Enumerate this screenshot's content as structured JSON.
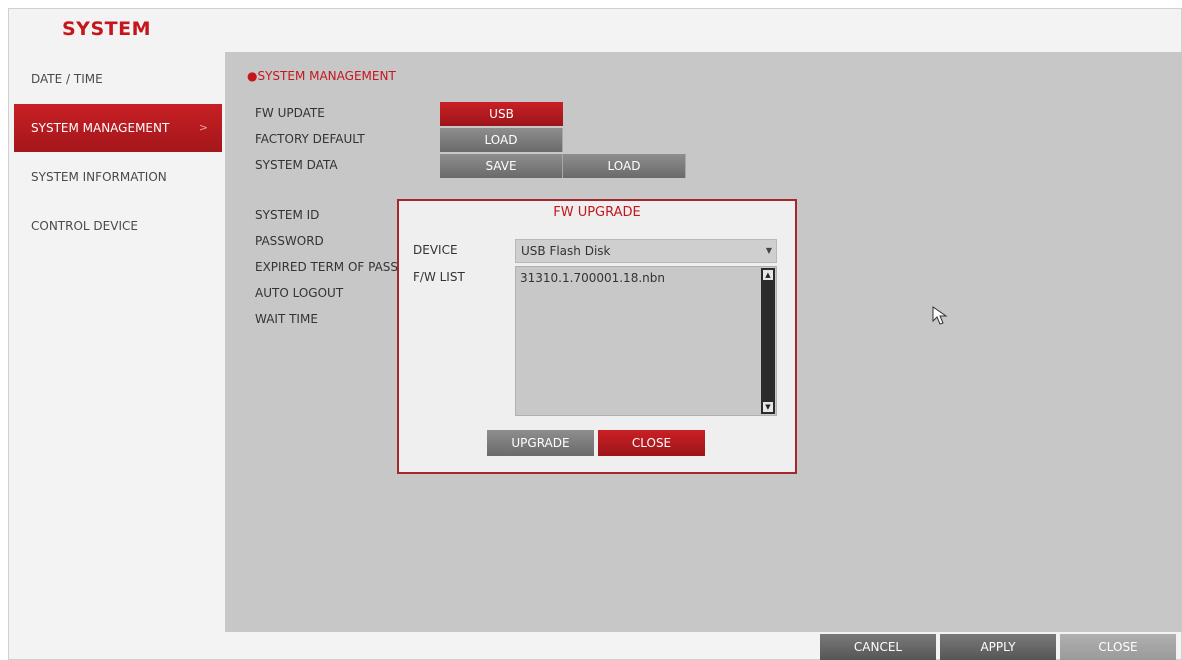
{
  "app": {
    "title": "SYSTEM"
  },
  "sidebar": {
    "items": [
      {
        "label": "DATE / TIME",
        "active": false
      },
      {
        "label": "SYSTEM MANAGEMENT",
        "active": true
      },
      {
        "label": "SYSTEM INFORMATION",
        "active": false
      },
      {
        "label": "CONTROL DEVICE",
        "active": false
      }
    ],
    "active_arrow": ">"
  },
  "main": {
    "section_title": "●SYSTEM MANAGEMENT",
    "rows": {
      "fw_update": {
        "label": "FW UPDATE",
        "button": "USB"
      },
      "factory_default": {
        "label": "FACTORY DEFAULT",
        "button": "LOAD"
      },
      "system_data": {
        "label": "SYSTEM DATA",
        "save_button": "SAVE",
        "load_button": "LOAD"
      }
    },
    "labels": {
      "system_id": "SYSTEM ID",
      "password": "PASSWORD",
      "expired_term": "EXPIRED TERM OF PASS",
      "auto_logout": "AUTO LOGOUT",
      "wait_time": "WAIT TIME"
    }
  },
  "dialog": {
    "title": "FW UPGRADE",
    "device_label": "DEVICE",
    "device_value": "USB Flash Disk",
    "fw_list_label": "F/W LIST",
    "fw_list_items": [
      "31310.1.700001.18.nbn"
    ],
    "upgrade_button": "UPGRADE",
    "close_button": "CLOSE"
  },
  "footer": {
    "cancel": "CANCEL",
    "apply": "APPLY",
    "close": "CLOSE"
  },
  "colors": {
    "accent_red": "#c4161c",
    "button_gray": "#6a6a6a",
    "panel_gray": "#c7c7c7"
  }
}
